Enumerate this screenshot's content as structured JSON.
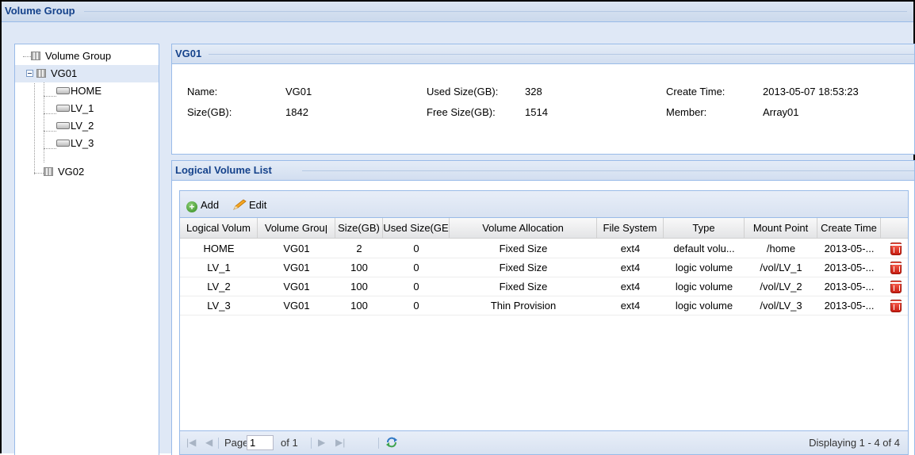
{
  "window": {
    "title": "Volume Group"
  },
  "tree": {
    "root": "Volume Group",
    "vg01": {
      "label": "VG01",
      "children": [
        "HOME",
        "LV_1",
        "LV_2",
        "LV_3"
      ]
    },
    "vg02": {
      "label": "VG02"
    }
  },
  "vg_panel": {
    "title": "VG01",
    "name_label": "Name:",
    "name_value": "VG01",
    "size_label": "Size(GB):",
    "size_value": "1842",
    "used_label": "Used Size(GB):",
    "used_value": "328",
    "free_label": "Free Size(GB):",
    "free_value": "1514",
    "create_label": "Create Time:",
    "create_value": "2013-05-07 18:53:23",
    "member_label": "Member:",
    "member_value": "Array01"
  },
  "lv_panel": {
    "title": "Logical Volume List",
    "toolbar": {
      "add": "Add",
      "edit": "Edit"
    },
    "columns": [
      "Logical Volum",
      "Volume Grouן",
      "Size(GB)",
      "Used Size(GE",
      "Volume Allocation",
      "File System",
      "Type",
      "Mount Point",
      "Create Time"
    ],
    "rows": [
      [
        "HOME",
        "VG01",
        "2",
        "0",
        "Fixed Size",
        "ext4",
        "default volu...",
        "/home",
        "2013-05-..."
      ],
      [
        "LV_1",
        "VG01",
        "100",
        "0",
        "Fixed Size",
        "ext4",
        "logic volume",
        "/vol/LV_1",
        "2013-05-..."
      ],
      [
        "LV_2",
        "VG01",
        "100",
        "0",
        "Fixed Size",
        "ext4",
        "logic volume",
        "/vol/LV_2",
        "2013-05-..."
      ],
      [
        "LV_3",
        "VG01",
        "100",
        "0",
        "Thin Provision",
        "ext4",
        "logic volume",
        "/vol/LV_3",
        "2013-05-..."
      ]
    ],
    "paging": {
      "page_label": "Page",
      "page_value": "1",
      "of_label": "of 1",
      "display_text": "Displaying 1 - 4 of 4"
    }
  },
  "colors": {
    "header_text": "#15428b",
    "panel_border": "#99bbe8",
    "background": "#dfe8f6",
    "delete_icon": "#d9251a"
  }
}
